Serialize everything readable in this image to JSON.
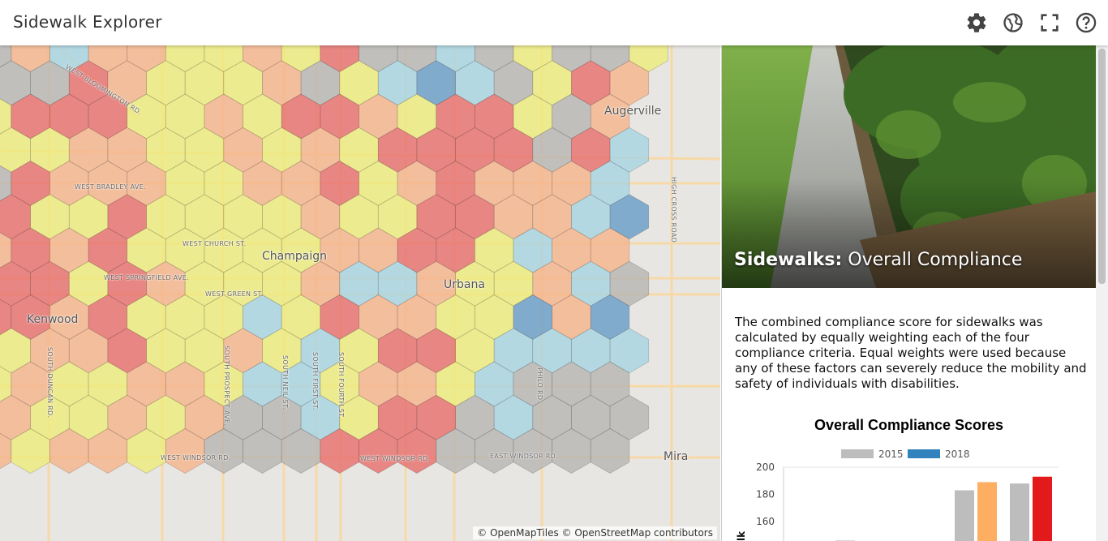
{
  "app": {
    "title": "Sidewalk Explorer",
    "toolbar": [
      {
        "name": "settings",
        "icon": "gear-icon"
      },
      {
        "name": "language",
        "icon": "globe-icon"
      },
      {
        "name": "fullscreen",
        "icon": "fullscreen-icon"
      },
      {
        "name": "help",
        "icon": "help-icon"
      }
    ]
  },
  "map": {
    "city_labels": [
      "Champaign",
      "Urbana",
      "Kenwood",
      "Augerville",
      "Mira"
    ],
    "street_labels": {
      "bloomington": "WEST BLOOMINGTON RD.",
      "bradley": "WEST BRADLEY AVE.",
      "church": "WEST CHURCH ST.",
      "springfield": "WEST SPRINGFIELD AVE.",
      "green": "WEST GREEN ST.",
      "windsor_w": "WEST WINDSOR RD.",
      "windsor_mid": "WEST WINDSOR RD.",
      "windsor_e": "EAST WINDSOR RD.",
      "duncan": "SOUTH DUNCAN RD.",
      "prospect": "SOUTH PROSPECT AVE.",
      "neil": "SOUTH NEIL ST.",
      "first": "SOUTH FIRST ST.",
      "fourth": "SOUTH FOURTH ST.",
      "philo": "PHILO RD.",
      "highcross": "HIGH CROSS ROAD"
    },
    "attribution": "© OpenMapTiles © OpenStreetMap contributors",
    "colors": {
      "red": "#e8706e",
      "orange": "#f5b48c",
      "yellow": "#eeec7c",
      "lightblue": "#a8d4e2",
      "blue": "#6a9ec8",
      "gray": "#b8b6b3"
    }
  },
  "panel": {
    "hero_title_bold": "Sidewalks:",
    "hero_title_rest": " Overall Compliance",
    "description": "The combined compliance score for sidewalks was calculated by equally weighting each of the four compliance criteria. Equal weights were used because any of these factors can severely reduce the mobility and safety of individuals with disabilities."
  },
  "chart_data": {
    "type": "bar",
    "title": "Overall Compliance Scores",
    "ylabel_visible_fragment": "lk",
    "series": [
      {
        "name": "2015",
        "color": "#bdbdbd",
        "values": [
          146,
          183,
          188
        ]
      },
      {
        "name": "2018",
        "color": "#3182bd",
        "values": [
          null,
          189,
          193
        ]
      }
    ],
    "bar_colors_2018": [
      "#3182bd",
      "#fdae61",
      "#e31a1c"
    ],
    "yticks": [
      160,
      180,
      200
    ],
    "ylim_visible": [
      136,
      200
    ]
  }
}
